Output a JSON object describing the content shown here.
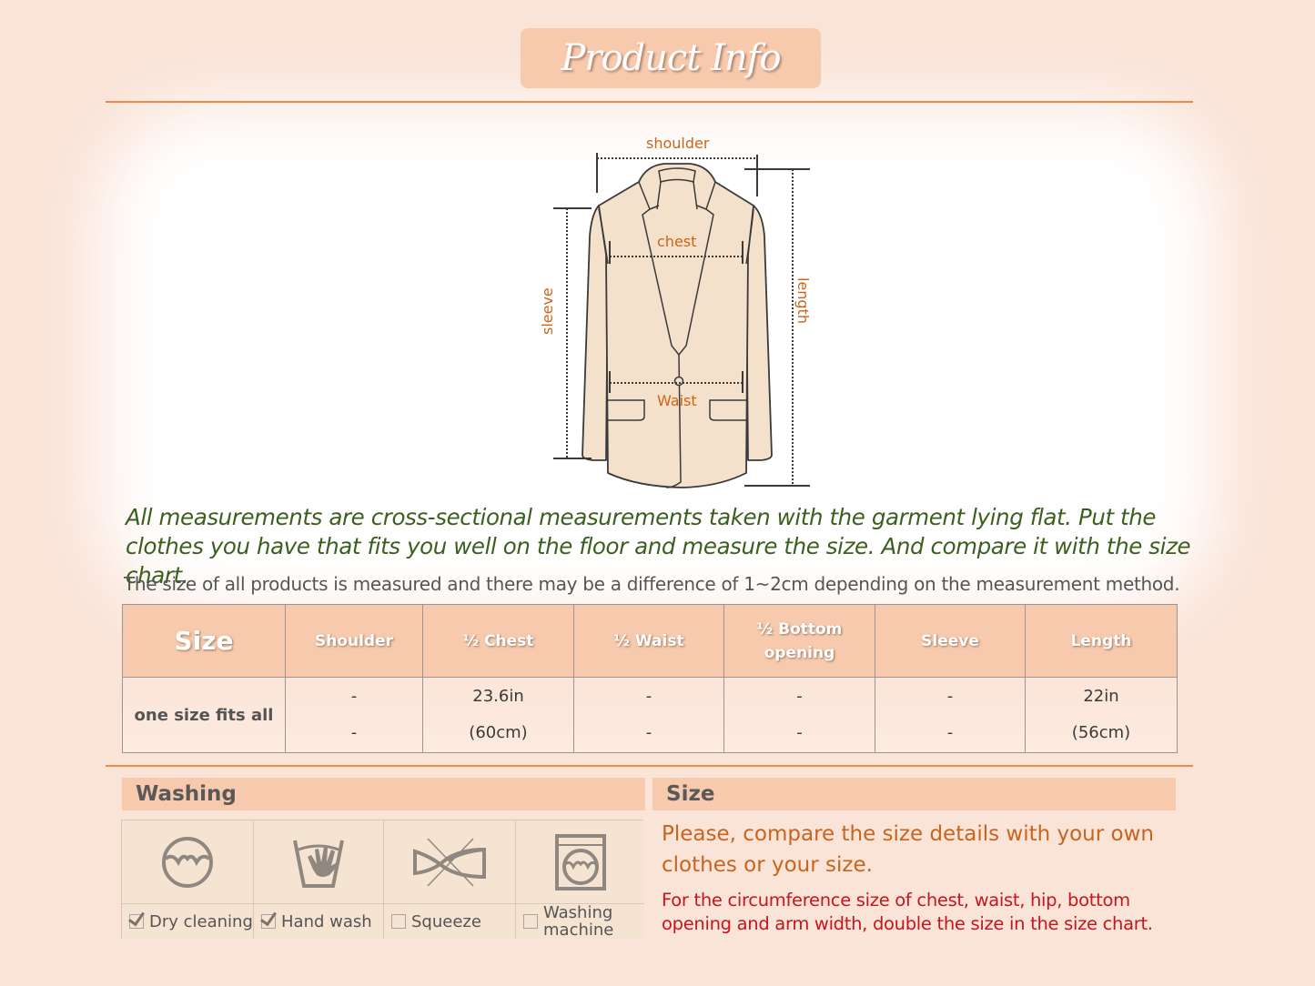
{
  "header": {
    "title": "Product Info"
  },
  "diagram": {
    "labels": {
      "shoulder": "shoulder",
      "chest": "chest",
      "waist": "Waist",
      "sleeve": "sleeve",
      "length": "length"
    }
  },
  "intro": {
    "italic_text": "All measurements are cross-sectional measurements taken with the garment lying flat. Put the clothes you have that fits you well on the floor and measure the size. And compare it with the size chart.",
    "note": "The size of all products is measured and there may be a difference of 1~2cm depending on the measurement method."
  },
  "size_table": {
    "headers": [
      "Size",
      "Shoulder",
      "½ Chest",
      "½ Waist",
      "½ Bottom opening",
      "Sleeve",
      "Length"
    ],
    "rows": [
      {
        "size": "one size fits all",
        "cells": [
          [
            "-",
            "-"
          ],
          [
            "23.6in",
            "(60cm)"
          ],
          [
            "-",
            "-"
          ],
          [
            "-",
            "-"
          ],
          [
            "-",
            "-"
          ],
          [
            "22in",
            "(56cm)"
          ]
        ]
      }
    ]
  },
  "washing": {
    "title": "Washing",
    "items": [
      {
        "label": "Dry cleaning",
        "icon": "dry-cleaning-icon",
        "checked": true
      },
      {
        "label": "Hand wash",
        "icon": "hand-wash-icon",
        "checked": true
      },
      {
        "label": "Squeeze",
        "icon": "no-wring-icon",
        "checked": false
      },
      {
        "label": "Washing machine",
        "icon": "washing-machine-icon",
        "checked": false
      }
    ]
  },
  "size_section": {
    "title": "Size",
    "main_text": "Please, compare the size details with your own clothes or your size.",
    "sub_text": "For the circumference size of chest, waist, hip, bottom opening and arm width, double the size in the size chart."
  },
  "colors": {
    "accent_orange": "#ee8a45",
    "header_peach": "#f7c9ad",
    "label_orange": "#cc6419",
    "intro_green": "#3b5f1f",
    "note_red": "#c4161c"
  }
}
